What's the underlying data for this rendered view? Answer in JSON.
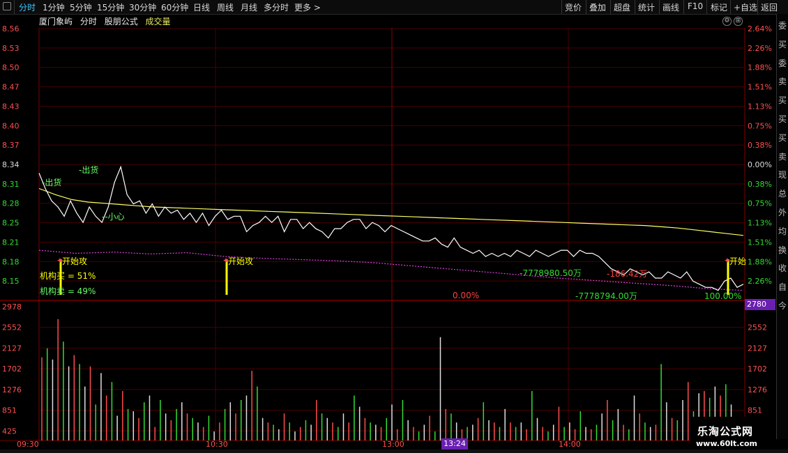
{
  "toolbar": {
    "tabs": [
      "分时",
      "1分钟",
      "5分钟",
      "15分钟",
      "30分钟",
      "60分钟",
      "日线",
      "周线",
      "月线",
      "多分时",
      "更多 >"
    ],
    "right_buttons": [
      "竞价",
      "叠加",
      "超盘",
      "统计",
      "画线",
      "F10",
      "标记",
      "+自选",
      "返回"
    ]
  },
  "header": {
    "stock_name": "厦门象屿",
    "mode": "分时",
    "formula": "股朋公式",
    "indicator": "成交量"
  },
  "colors": {
    "price_line": "#ffffff",
    "avg_line": "#ffff66",
    "magenta_line": "#e040e0",
    "grid": "#4a0000",
    "up_tick": "#ff4d4d",
    "down_tick": "#33dd33",
    "label_yellow": "#ffff00",
    "label_green": "#66ff66",
    "highlight": "#6b1fb2"
  },
  "chart_data": {
    "type": "line",
    "price_axis": [
      "8.56",
      "8.53",
      "8.50",
      "8.47",
      "8.43",
      "8.40",
      "8.37",
      "8.34",
      "8.31",
      "8.28",
      "8.25",
      "8.21",
      "8.18",
      "8.15"
    ],
    "pct_axis": [
      "2.64%",
      "2.26%",
      "1.88%",
      "1.51%",
      "1.13%",
      "0.75%",
      "0.38%",
      "0.00%",
      "0.38%",
      "0.75%",
      "1.13%",
      "1.51%",
      "1.88%",
      "2.26%"
    ],
    "volume_axis": [
      "2978",
      "2552",
      "2127",
      "1702",
      "1276",
      "851",
      "425"
    ],
    "volume_axis_right": [
      "2552",
      "2127",
      "1702",
      "1276",
      "851",
      "425"
    ],
    "time_axis": [
      "09:30",
      "10:30",
      "13:00",
      "14:00"
    ],
    "ylim": [
      8.13,
      8.57
    ],
    "vol_lim": [
      0,
      2978
    ],
    "price": [
      8.335,
      8.31,
      8.29,
      8.28,
      8.265,
      8.29,
      8.27,
      8.255,
      8.28,
      8.265,
      8.255,
      8.28,
      8.32,
      8.345,
      8.3,
      8.285,
      8.29,
      8.27,
      8.285,
      8.265,
      8.28,
      8.27,
      8.275,
      8.26,
      8.27,
      8.255,
      8.27,
      8.25,
      8.265,
      8.275,
      8.26,
      8.265,
      8.265,
      8.24,
      8.25,
      8.255,
      8.265,
      8.255,
      8.265,
      8.24,
      8.26,
      8.26,
      8.245,
      8.255,
      8.245,
      8.24,
      8.23,
      8.245,
      8.245,
      8.255,
      8.26,
      8.26,
      8.245,
      8.255,
      8.25,
      8.24,
      8.25,
      8.245,
      8.24,
      8.235,
      8.23,
      8.225,
      8.225,
      8.23,
      8.22,
      8.215,
      8.23,
      8.215,
      8.21,
      8.205,
      8.21,
      8.2,
      8.205,
      8.2,
      8.205,
      8.2,
      8.21,
      8.205,
      8.2,
      8.21,
      8.205,
      8.2,
      8.205,
      8.21,
      8.21,
      8.2,
      8.21,
      8.205,
      8.205,
      8.2,
      8.19,
      8.18,
      8.175,
      8.17,
      8.18,
      8.175,
      8.17,
      8.175,
      8.165,
      8.165,
      8.175,
      8.17,
      8.165,
      8.175,
      8.16,
      8.155,
      8.15,
      8.15,
      8.145,
      8.16,
      8.165,
      8.15,
      8.155
    ],
    "avg": [
      8.31,
      8.3,
      8.292,
      8.288,
      8.286,
      8.284,
      8.282,
      8.28,
      8.279,
      8.278,
      8.277,
      8.276,
      8.275,
      8.274,
      8.273,
      8.272,
      8.271,
      8.27,
      8.269,
      8.268,
      8.267,
      8.266,
      8.265,
      8.264,
      8.263,
      8.262,
      8.261,
      8.26,
      8.259,
      8.258,
      8.257,
      8.256,
      8.255,
      8.254,
      8.253,
      8.252,
      8.251,
      8.25,
      8.248,
      8.246,
      8.243,
      8.24,
      8.237,
      8.234
    ],
    "magenta": [
      8.21,
      8.205,
      8.207,
      8.204,
      8.206,
      8.2,
      8.197,
      8.195,
      8.193,
      8.19,
      8.185,
      8.18,
      8.175,
      8.17,
      8.165,
      8.161,
      8.157,
      8.153,
      8.148,
      8.145
    ],
    "volume": [
      1850,
      2050,
      1800,
      2700,
      2200,
      1650,
      1900,
      1700,
      1200,
      1650,
      800,
      1500,
      1000,
      1300,
      550,
      1100,
      700,
      650,
      500,
      850,
      1000,
      300,
      900,
      600,
      450,
      700,
      850,
      600,
      500,
      400,
      300,
      550,
      200,
      400,
      700,
      850,
      600,
      900,
      1000,
      1550,
      1200,
      500,
      400,
      350,
      250,
      600,
      400,
      200,
      300,
      450,
      350,
      900,
      600,
      500,
      400,
      300,
      600,
      400,
      1000,
      750,
      500,
      400,
      350,
      300,
      500,
      800,
      250,
      900,
      450,
      300,
      200,
      350,
      550,
      200,
      2300,
      700,
      600,
      400,
      250,
      300,
      350,
      500,
      850,
      450,
      400,
      300,
      700,
      400,
      300,
      400,
      250,
      1100,
      500,
      300,
      200,
      350,
      750,
      300,
      400,
      250,
      650,
      300,
      250,
      350,
      600,
      900,
      450,
      700,
      350,
      250,
      1000,
      600,
      400,
      300,
      350,
      1700,
      850,
      500,
      450,
      900,
      1300,
      650,
      1050,
      1100,
      950,
      1200,
      1000,
      1250,
      800,
      500
    ]
  },
  "annotations": {
    "sell1": "-出货",
    "sell2": "-出货",
    "caution": "--小心",
    "attack1": "开始攻",
    "attack2": "开始攻",
    "attack3": "开始",
    "inst_buy": "机构买 = 51%",
    "inst_sell": "机构卖 = 49%",
    "zero_pct": "0.00%",
    "flow1": "-7778980.50万",
    "flow2": "-7778794.00万",
    "red_val": "-186.42万",
    "hundred_pct": "100.00%"
  },
  "tags": {
    "time": "13:24",
    "volume": "2780"
  },
  "right_labels": [
    "委",
    "买",
    "委",
    "卖",
    "买",
    "买",
    "买",
    "卖",
    "现",
    "总",
    "外",
    "均",
    "换",
    "收",
    "自",
    "今"
  ],
  "logo": {
    "line1": "乐淘公式网",
    "line2": "www.60lt.com"
  }
}
